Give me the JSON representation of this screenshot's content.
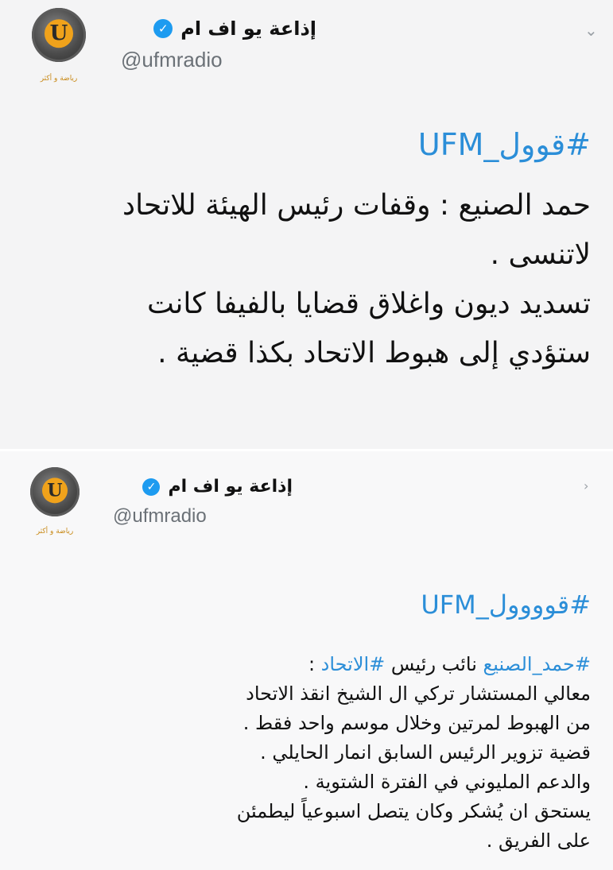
{
  "tweets": [
    {
      "display_name": "إذاعة يو اف ام",
      "handle": "@ufmradio",
      "avatar_letter": "U",
      "avatar_caption": "رياضة و أكثر",
      "hashtag": "#قوول_UFM",
      "lines": [
        "حمد الصنيع : وقفات رئيس الهيئة للاتحاد",
        "لاتنسى .",
        "تسديد ديون واغلاق قضايا بالفيفا كانت",
        "ستؤدي إلى هبوط الاتحاد بكذا قضية ."
      ]
    },
    {
      "display_name": "إذاعة يو اف ام",
      "handle": "@ufmradio",
      "avatar_letter": "U",
      "avatar_caption": "رياضة و أكثر",
      "hashtag": "#قوووول_UFM",
      "first_line": {
        "tag1": "#حمد_الصنيع",
        "middle": " نائب رئيس ",
        "tag2": "#الاتحاد",
        "end": " :"
      },
      "lines": [
        "معالي المستشار تركي ال الشيخ انقذ الاتحاد",
        "من الهبوط لمرتين وخلال موسم واحد فقط .",
        "قضية تزوير الرئيس السابق انمار الحايلي .",
        "والدعم المليوني في الفترة الشتوية .",
        "يستحق ان يُشكر وكان يتصل اسبوعياً ليطمئن",
        "على الفريق ."
      ]
    }
  ],
  "icons": {
    "verified": "verified-badge-icon",
    "menu": "chevron-down-icon"
  },
  "colors": {
    "link": "#2b8ed8",
    "verified": "#1d9bf0",
    "avatar_accent": "#f0a21b"
  }
}
